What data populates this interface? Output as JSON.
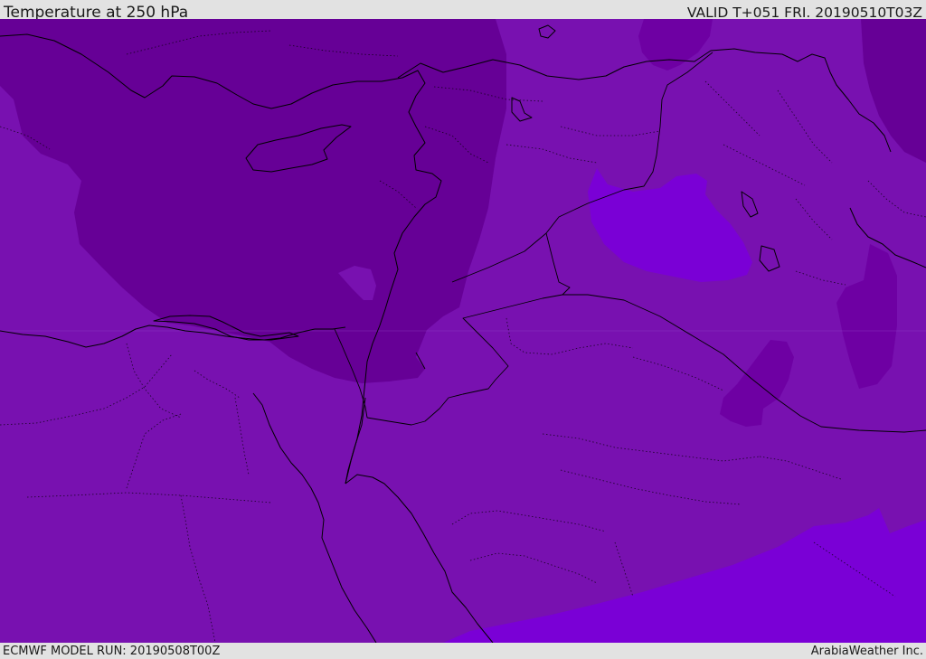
{
  "header": {
    "title": "Temperature at 250 hPa",
    "valid_time": "VALID T+051 FRI. 20190510T03Z"
  },
  "footer": {
    "model_run": "ECMWF MODEL RUN: 20190508T00Z",
    "provider": "ArabiaWeather Inc."
  },
  "map": {
    "field": "temperature",
    "level_hpa": 250,
    "region": "Eastern Mediterranean / Egypt / Levant / Arabia",
    "colors": {
      "coldest": "#660096",
      "colder": "#6e00a3",
      "base": "#7811b0",
      "warmer": "#7a00d6",
      "boundary_line": "#000000"
    }
  }
}
